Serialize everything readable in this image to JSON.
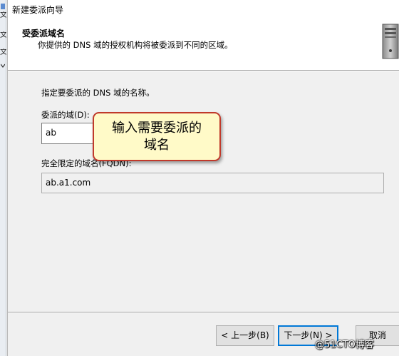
{
  "background": {
    "glyphs": [
      "文",
      "文",
      "文"
    ]
  },
  "dialog": {
    "title": "新建委派向导",
    "header_title": "受委派域名",
    "header_subtitle": "你提供的 DNS 域的授权机构将被委派到不同的区域。",
    "instruction": "指定要委派的 DNS 域的名称。",
    "domain_label": "委派的域(D):",
    "domain_value": "ab",
    "fqdn_label": "完全限定的域名(FQDN):",
    "fqdn_value": "ab.a1.com"
  },
  "callout": {
    "line1": "输入需要委派的",
    "line2": "域名"
  },
  "buttons": {
    "back": "< 上一步(B)",
    "next": "下一步(N) >",
    "cancel": "取消"
  },
  "watermark": "@51CTO博客",
  "colors": {
    "callout_fill": "#fffac8",
    "callout_border": "#c0392b",
    "default_button_border": "#0078d7"
  }
}
